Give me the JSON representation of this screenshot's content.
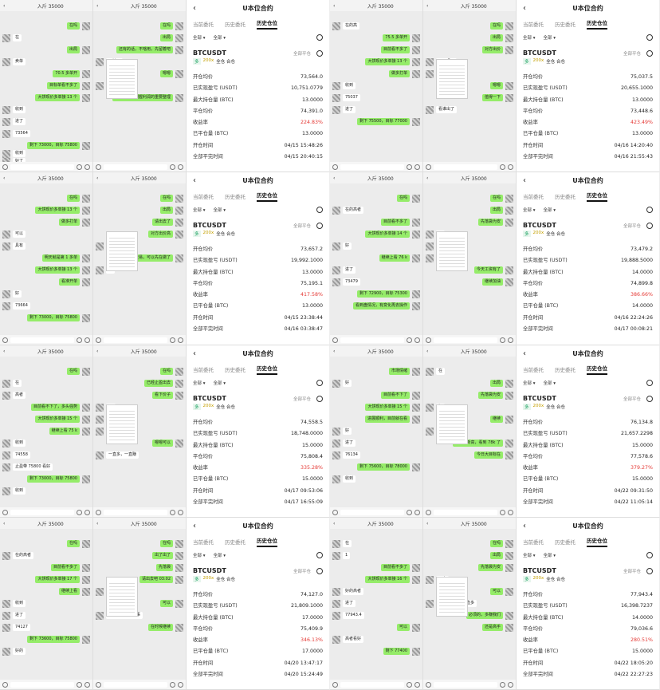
{
  "chat_panels": [
    {
      "title": "入斤 35000",
      "messages": [
        {
          "side": "r",
          "text": "在吗"
        },
        {
          "side": "l",
          "text": "在"
        },
        {
          "side": "r",
          "text": "出局"
        },
        {
          "side": "l",
          "text": "卖单"
        },
        {
          "side": "r",
          "text": "70.5 多单开"
        },
        {
          "side": "r",
          "text": "目标单看不多了"
        },
        {
          "side": "r",
          "text": "大饼现价多单接 13 个"
        },
        {
          "side": "l",
          "text": "收到"
        },
        {
          "side": "l",
          "text": "进了"
        },
        {
          "side": "l",
          "text": "73564"
        },
        {
          "side": "r",
          "text": "剩下 73000，目标 75800"
        },
        {
          "side": "l",
          "text": "收到"
        },
        {
          "side": "l",
          "text": "好了"
        }
      ]
    },
    {
      "title": "入斤 35000",
      "messages": [
        {
          "side": "r",
          "text": "在吗"
        },
        {
          "side": "r",
          "text": "出局"
        },
        {
          "side": "r",
          "text": "还有的话，不啥用，先留着吧"
        },
        {
          "side": "l",
          "text": "平掉了"
        },
        {
          "side": "r",
          "text": "嗯嗯"
        },
        {
          "side": "l",
          "text": "今天是否是好"
        },
        {
          "side": "r",
          "text": "嗯嗯，值得把握利润的重要整理"
        }
      ]
    },
    {
      "title": "入斤 35000",
      "messages": [
        {
          "side": "r",
          "text": "在吗"
        },
        {
          "side": "r",
          "text": "大饼现价多单接 13 个"
        },
        {
          "side": "r",
          "text": "做多打单"
        },
        {
          "side": "l",
          "text": "可以"
        },
        {
          "side": "l",
          "text": "具有"
        },
        {
          "side": "r",
          "text": "明天就是第 1 多单"
        },
        {
          "side": "r",
          "text": "大饼现价多单接 13 个"
        },
        {
          "side": "r",
          "text": "看准开单"
        },
        {
          "side": "l",
          "text": "好"
        },
        {
          "side": "l",
          "text": "73664"
        },
        {
          "side": "r",
          "text": "剩下 73000，目标 75800"
        }
      ]
    },
    {
      "title": "入斤 35000",
      "messages": [
        {
          "side": "r",
          "text": "在吗"
        },
        {
          "side": "r",
          "text": "出局"
        },
        {
          "side": "r",
          "text": "请出去了"
        },
        {
          "side": "r",
          "text": "对方出价高"
        },
        {
          "side": "l",
          "text": "平了"
        },
        {
          "side": "r",
          "text": "今天就是交易，可以先在做了"
        },
        {
          "side": "l",
          "text": "好"
        }
      ]
    },
    {
      "title": "入斤 35000",
      "messages": [
        {
          "side": "r",
          "text": "在吗"
        },
        {
          "side": "l",
          "text": "在"
        },
        {
          "side": "l",
          "text": "高者"
        },
        {
          "side": "r",
          "text": "目前看不下了，多头强势"
        },
        {
          "side": "r",
          "text": "大饼现价多单接 15 个"
        },
        {
          "side": "r",
          "text": "继续上看 75 k"
        },
        {
          "side": "l",
          "text": "收到"
        },
        {
          "side": "l",
          "text": "74558"
        },
        {
          "side": "l",
          "text": "止盈带 75800 看好"
        },
        {
          "side": "r",
          "text": "剩下 73000，目标 75800"
        },
        {
          "side": "l",
          "text": "收到"
        }
      ]
    },
    {
      "title": "入斤 35000",
      "messages": [
        {
          "side": "r",
          "text": "在吗"
        },
        {
          "side": "r",
          "text": "已经止盈出去"
        },
        {
          "side": "r",
          "text": "看下价子"
        },
        {
          "side": "l",
          "text": "11"
        },
        {
          "side": "l",
          "text": "好"
        },
        {
          "side": "l",
          "text": "我稍好"
        },
        {
          "side": "r",
          "text": "嗯嗯可以"
        },
        {
          "side": "l",
          "text": "一直多，一直赚"
        }
      ]
    },
    {
      "title": "入斤 35000",
      "messages": [
        {
          "side": "r",
          "text": "在吗"
        },
        {
          "side": "l",
          "text": "在的高者"
        },
        {
          "side": "r",
          "text": "目前看不多了"
        },
        {
          "side": "r",
          "text": "大饼现价多单接 17 个"
        },
        {
          "side": "r",
          "text": "继续上看"
        },
        {
          "side": "l",
          "text": "收到"
        },
        {
          "side": "l",
          "text": "进了"
        },
        {
          "side": "l",
          "text": "74127"
        },
        {
          "side": "r",
          "text": "剩下 73600，目标 75800"
        },
        {
          "side": "l",
          "text": "好的"
        }
      ]
    },
    {
      "title": "入斤 35000",
      "messages": [
        {
          "side": "r",
          "text": "在吗"
        },
        {
          "side": "r",
          "text": "出了出了"
        },
        {
          "side": "r",
          "text": "先落袋"
        },
        {
          "side": "r",
          "text": "请出去吧 03:02"
        },
        {
          "side": "l",
          "text": "平掉了"
        },
        {
          "side": "r",
          "text": "可以"
        },
        {
          "side": "l",
          "text": "高出一切我们的事"
        },
        {
          "side": "r",
          "text": "在时候继续"
        }
      ]
    },
    {
      "title": "入斤 35000",
      "messages": [
        {
          "side": "l",
          "text": "在的高"
        },
        {
          "side": "r",
          "text": "75.5 多单开"
        },
        {
          "side": "r",
          "text": "目前看不多了"
        },
        {
          "side": "r",
          "text": "大饼现价多单接 13 个"
        },
        {
          "side": "r",
          "text": "做多打单"
        },
        {
          "side": "l",
          "text": "收到"
        },
        {
          "side": "l",
          "text": "75037"
        },
        {
          "side": "l",
          "text": "进了"
        },
        {
          "side": "r",
          "text": "剩下 75500，目标 77000"
        }
      ]
    },
    {
      "title": "入斤 35000",
      "messages": [
        {
          "side": "r",
          "text": "在吗"
        },
        {
          "side": "r",
          "text": "出局"
        },
        {
          "side": "r",
          "text": "对方出价"
        },
        {
          "side": "l",
          "text": "平了吗？"
        },
        {
          "side": "l",
          "text": "是能赚吗"
        },
        {
          "side": "r",
          "text": "嗯嗯"
        },
        {
          "side": "r",
          "text": "值得一下"
        },
        {
          "side": "l",
          "text": "看谁出了"
        }
      ]
    },
    {
      "title": "入斤 35000",
      "messages": [
        {
          "side": "r",
          "text": "在吗"
        },
        {
          "side": "l",
          "text": "在的高者"
        },
        {
          "side": "r",
          "text": "目前看不多了"
        },
        {
          "side": "r",
          "text": "大饼现价多单接 14 个"
        },
        {
          "side": "l",
          "text": "好"
        },
        {
          "side": "r",
          "text": "继续上看 76 k"
        },
        {
          "side": "l",
          "text": "进了"
        },
        {
          "side": "l",
          "text": "73479"
        },
        {
          "side": "r",
          "text": "剩下 72900，目标 75300"
        },
        {
          "side": "r",
          "text": "看到盘情况，有变化再去操作"
        }
      ]
    },
    {
      "title": "入斤 35000",
      "messages": [
        {
          "side": "r",
          "text": "在吗"
        },
        {
          "side": "r",
          "text": "出局"
        },
        {
          "side": "r",
          "text": "先落袋为安"
        },
        {
          "side": "l",
          "text": "??"
        },
        {
          "side": "l",
          "text": "已平"
        },
        {
          "side": "l",
          "text": "高手厉害"
        },
        {
          "side": "r",
          "text": "今天工资有了"
        },
        {
          "side": "r",
          "text": "继续加油"
        }
      ]
    },
    {
      "title": "入斤 35000",
      "messages": [
        {
          "side": "r",
          "text": "市场情绪"
        },
        {
          "side": "l",
          "text": "好"
        },
        {
          "side": "r",
          "text": "目前看不下了"
        },
        {
          "side": "r",
          "text": "大饼现价多单接 15 个"
        },
        {
          "side": "r",
          "text": "进展顺利，目前就在看"
        },
        {
          "side": "l",
          "text": "好"
        },
        {
          "side": "l",
          "text": "进了"
        },
        {
          "side": "l",
          "text": "76134"
        },
        {
          "side": "r",
          "text": "剩下 75600，目标 78000"
        },
        {
          "side": "l",
          "text": "收到"
        }
      ]
    },
    {
      "title": "入斤 35000",
      "messages": [
        {
          "side": "l",
          "text": "在"
        },
        {
          "side": "r",
          "text": "出局"
        },
        {
          "side": "r",
          "text": "先落袋为安"
        },
        {
          "side": "l",
          "text": "好"
        },
        {
          "side": "r",
          "text": "继续"
        },
        {
          "side": "l",
          "text": "高手帮帮"
        },
        {
          "side": "r",
          "text": "必须的新高，看到 78k 了"
        },
        {
          "side": "r",
          "text": "今日大目标在"
        }
      ]
    },
    {
      "title": "入斤 35000",
      "messages": [
        {
          "side": "l",
          "text": "在"
        },
        {
          "side": "l",
          "text": "1"
        },
        {
          "side": "r",
          "text": "目前看不多了"
        },
        {
          "side": "r",
          "text": "大饼现价多单接 16 个"
        },
        {
          "side": "l",
          "text": "好的高者"
        },
        {
          "side": "l",
          "text": "进了"
        },
        {
          "side": "l",
          "text": "77943.4"
        },
        {
          "side": "r",
          "text": "可以"
        },
        {
          "side": "l",
          "text": "高者看好"
        },
        {
          "side": "r",
          "text": "剩下 77400"
        }
      ]
    },
    {
      "title": "入斤 35000",
      "messages": [
        {
          "side": "r",
          "text": "在吗"
        },
        {
          "side": "r",
          "text": "出局"
        },
        {
          "side": "r",
          "text": "先落袋为安"
        },
        {
          "side": "l",
          "text": "已出"
        },
        {
          "side": "r",
          "text": "可以"
        },
        {
          "side": "l",
          "text": "大赚了，谢谢一直多"
        },
        {
          "side": "r",
          "text": "必须的，多赚我们"
        },
        {
          "side": "r",
          "text": "还是高手"
        }
      ]
    }
  ],
  "trade_common": {
    "title": "U本位合约",
    "tabs": [
      "当前委托",
      "历史委托",
      "历史仓位"
    ],
    "filters": [
      "全部 ▾",
      "全部 ▾"
    ],
    "symbol": "BTCUSDT",
    "close_all": "全部平仓",
    "side": "多",
    "leverage": "200x",
    "margin_mode": "全仓 合仓",
    "row_labels": [
      "开仓均价",
      "已实现盈亏 (USDT)",
      "最大持仓量 (BTC)",
      "平仓均价",
      "收益率",
      "已平仓量 (BTC)",
      "开仓时间",
      "全部平完时间"
    ]
  },
  "trades": [
    {
      "open_price": "73,564.0",
      "pnl": "10,751.0779",
      "max_pos": "13.0000",
      "close_price": "74,391.0",
      "roi": "224.83%",
      "closed_qty": "13.0000",
      "open_time": "04/15 15:48:26",
      "close_time": "04/15 20:40:15"
    },
    {
      "open_price": "73,657.2",
      "pnl": "19,992.1000",
      "max_pos": "13.0000",
      "close_price": "75,195.1",
      "roi": "417.58%",
      "closed_qty": "13.0000",
      "open_time": "04/15 23:38:44",
      "close_time": "04/16 03:38:47"
    },
    {
      "open_price": "74,558.5",
      "pnl": "18,748.0000",
      "max_pos": "15.0000",
      "close_price": "75,808.4",
      "roi": "335.28%",
      "closed_qty": "15.0000",
      "open_time": "04/17 09:53:06",
      "close_time": "04/17 16:55:09"
    },
    {
      "open_price": "74,127.0",
      "pnl": "21,809.1000",
      "max_pos": "17.0000",
      "close_price": "75,409.9",
      "roi": "346.13%",
      "closed_qty": "17.0000",
      "open_time": "04/20 13:47:17",
      "close_time": "04/20 15:24:49"
    },
    {
      "open_price": "75,037.5",
      "pnl": "20,655.1000",
      "max_pos": "13.0000",
      "close_price": "73,448.6",
      "roi": "423.49%",
      "closed_qty": "13.0000",
      "open_time": "04/16 14:20:40",
      "close_time": "04/16 21:55:43"
    },
    {
      "open_price": "73,479.2",
      "pnl": "19,888.5000",
      "max_pos": "14.0000",
      "close_price": "74,899.8",
      "roi": "386.66%",
      "closed_qty": "14.0000",
      "open_time": "04/16 22:24:26",
      "close_time": "04/17 00:08:21"
    },
    {
      "open_price": "76,134.8",
      "pnl": "21,657.2298",
      "max_pos": "15.0000",
      "close_price": "77,578.6",
      "roi": "379.27%",
      "closed_qty": "15.0000",
      "open_time": "04/22 09:31:50",
      "close_time": "04/22 11:05:14"
    },
    {
      "open_price": "77,943.4",
      "pnl": "16,398.7237",
      "max_pos": "14.0000",
      "close_price": "79,036.6",
      "roi": "280.51%",
      "closed_qty": "15.0000",
      "open_time": "04/22 18:05:20",
      "close_time": "04/22 22:27:23"
    }
  ]
}
